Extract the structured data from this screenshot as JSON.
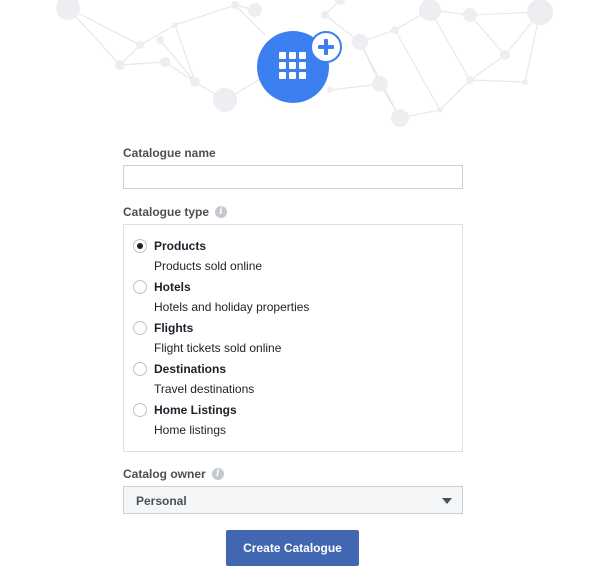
{
  "header": {
    "icon": "catalogue-grid-icon",
    "badge_icon": "plus-icon",
    "icon_color": "#3b7ff0"
  },
  "form": {
    "catalogue_name_label": "Catalogue name",
    "catalogue_name_value": "",
    "catalogue_type_label": "Catalogue type",
    "catalogue_types": [
      {
        "title": "Products",
        "description": "Products sold online",
        "selected": true
      },
      {
        "title": "Hotels",
        "description": "Hotels and holiday properties",
        "selected": false
      },
      {
        "title": "Flights",
        "description": "Flight tickets sold online",
        "selected": false
      },
      {
        "title": "Destinations",
        "description": "Travel destinations",
        "selected": false
      },
      {
        "title": "Home Listings",
        "description": "Home listings",
        "selected": false
      }
    ],
    "catalog_owner_label": "Catalog owner",
    "catalog_owner_value": "Personal",
    "submit_label": "Create Catalogue",
    "submit_color": "#4267b2"
  }
}
